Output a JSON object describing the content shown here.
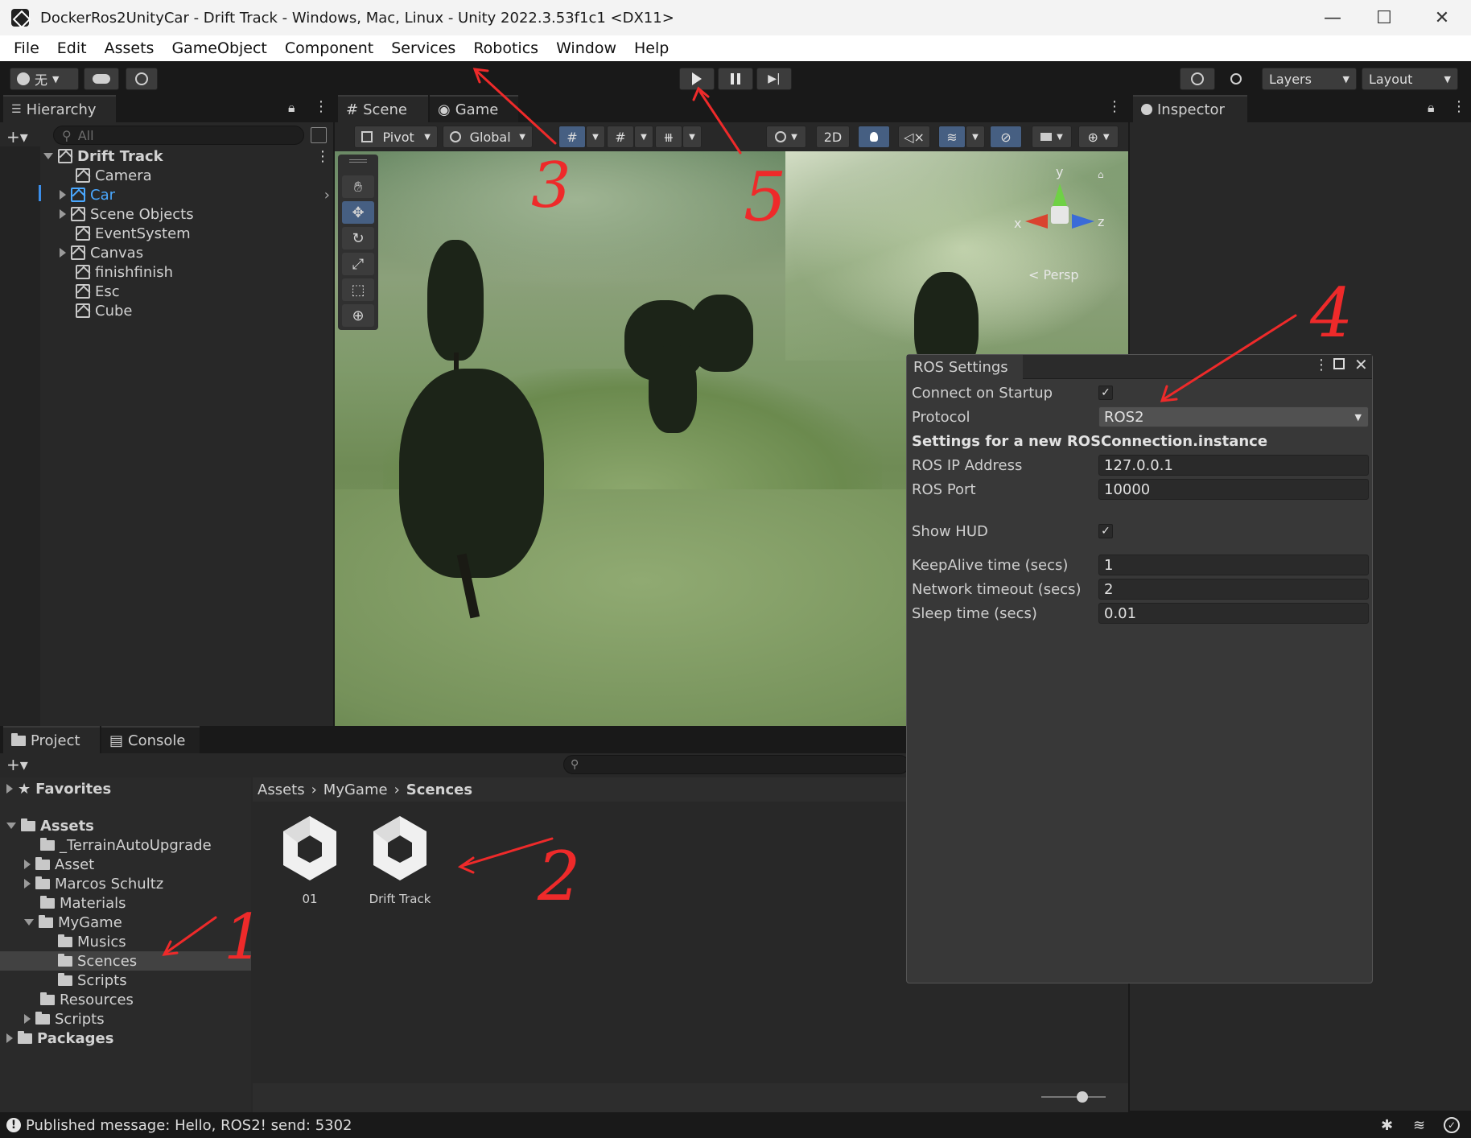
{
  "window": {
    "title": "DockerRos2UnityCar - Drift Track - Windows, Mac, Linux - Unity 2022.3.53f1c1 <DX11>",
    "minimize": "—",
    "maximize": "☐",
    "close": "✕"
  },
  "menu": [
    "File",
    "Edit",
    "Assets",
    "GameObject",
    "Component",
    "Services",
    "Robotics",
    "Window",
    "Help"
  ],
  "toolbar": {
    "account_label": "无",
    "layers_label": "Layers",
    "layout_label": "Layout"
  },
  "hierarchy": {
    "tab_label": "Hierarchy",
    "search_placeholder": "All",
    "scene_name": "Drift Track",
    "items": [
      "Camera",
      "Car",
      "Scene Objects",
      "EventSystem",
      "Canvas",
      "finishfinish",
      "Esc",
      "Cube"
    ]
  },
  "scene": {
    "tabs": [
      "Scene",
      "Game"
    ],
    "pivot_label": "Pivot",
    "global_label": "Global",
    "twod_label": "2D",
    "persp_label": "< Persp",
    "gizmo_y": "y",
    "gizmo_x": "x",
    "gizmo_z": "z"
  },
  "inspector": {
    "tab_label": "Inspector"
  },
  "ros_settings": {
    "title": "ROS Settings",
    "connect_on_startup_label": "Connect on Startup",
    "connect_on_startup": true,
    "protocol_label": "Protocol",
    "protocol_value": "ROS2",
    "section_header": "Settings for a new ROSConnection.instance",
    "ip_label": "ROS IP Address",
    "ip_value": "127.0.0.1",
    "port_label": "ROS Port",
    "port_value": "10000",
    "show_hud_label": "Show HUD",
    "show_hud": true,
    "keepalive_label": "KeepAlive time (secs)",
    "keepalive_value": "1",
    "network_timeout_label": "Network timeout (secs)",
    "network_timeout_value": "2",
    "sleep_label": "Sleep time (secs)",
    "sleep_value": "0.01"
  },
  "project": {
    "tabs": [
      "Project",
      "Console"
    ],
    "favorites": "Favorites",
    "assets_root": "Assets",
    "tree": [
      "_TerrainAutoUpgrade",
      "Asset",
      "Marcos Schultz",
      "Materials",
      "MyGame",
      "Musics",
      "Scences",
      "Scripts",
      "Resources",
      "Scripts",
      "Packages"
    ],
    "breadcrumb": [
      "Assets",
      "MyGame",
      "Scences"
    ],
    "files": [
      "01",
      "Drift Track"
    ]
  },
  "status": {
    "message": "Published message: Hello, ROS2! send: 5302"
  },
  "annotations": [
    "3",
    "5",
    "4",
    "2",
    "1"
  ]
}
